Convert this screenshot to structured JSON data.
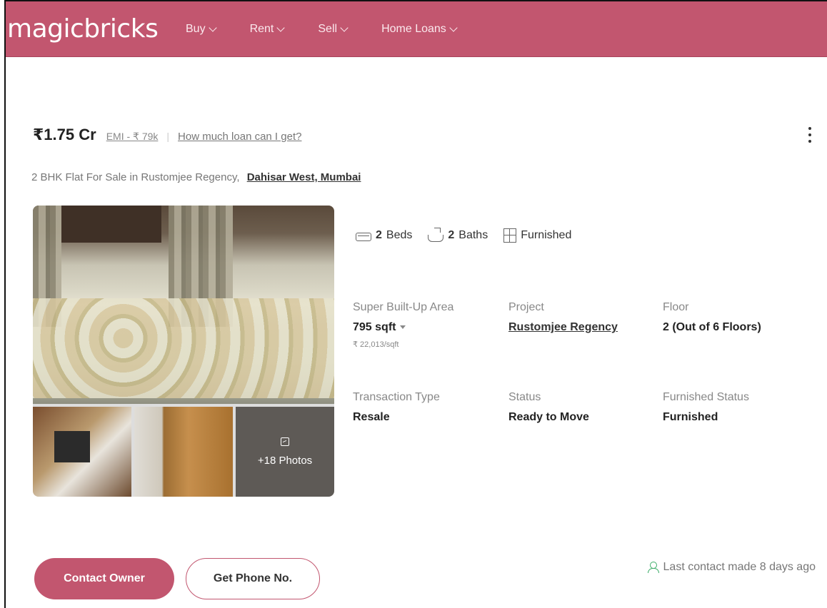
{
  "header": {
    "logo": "magicbricks",
    "nav": [
      {
        "label": "Buy"
      },
      {
        "label": "Rent"
      },
      {
        "label": "Sell"
      },
      {
        "label": "Home Loans"
      }
    ]
  },
  "listing": {
    "price": "₹1.75 Cr",
    "emi": "EMI - ₹ 79k",
    "loan_link": "How much loan can I get?",
    "subtitle": "2 BHK Flat For Sale in Rustomjee Regency,",
    "location": "Dahisar West, Mumbai",
    "more_photos": "+18 Photos",
    "facts": {
      "beds_count": "2",
      "beds_label": "Beds",
      "baths_count": "2",
      "baths_label": "Baths",
      "furnished": "Furnished"
    },
    "details": {
      "super_area_label": "Super Built-Up Area",
      "super_area_value": "795 sqft",
      "price_per_sqft": "₹ 22,013/sqft",
      "project_label": "Project",
      "project_value": "Rustomjee Regency",
      "floor_label": "Floor",
      "floor_value": "2 (Out of 6 Floors)",
      "transaction_label": "Transaction Type",
      "transaction_value": "Resale",
      "status_label": "Status",
      "status_value": "Ready to Move",
      "furnished_label": "Furnished Status",
      "furnished_value": "Furnished"
    },
    "actions": {
      "contact_owner": "Contact Owner",
      "get_phone": "Get Phone No."
    },
    "last_contact": "Last contact made 8 days ago"
  },
  "colors": {
    "brand": "#c2566f",
    "success": "#3fae6a"
  }
}
